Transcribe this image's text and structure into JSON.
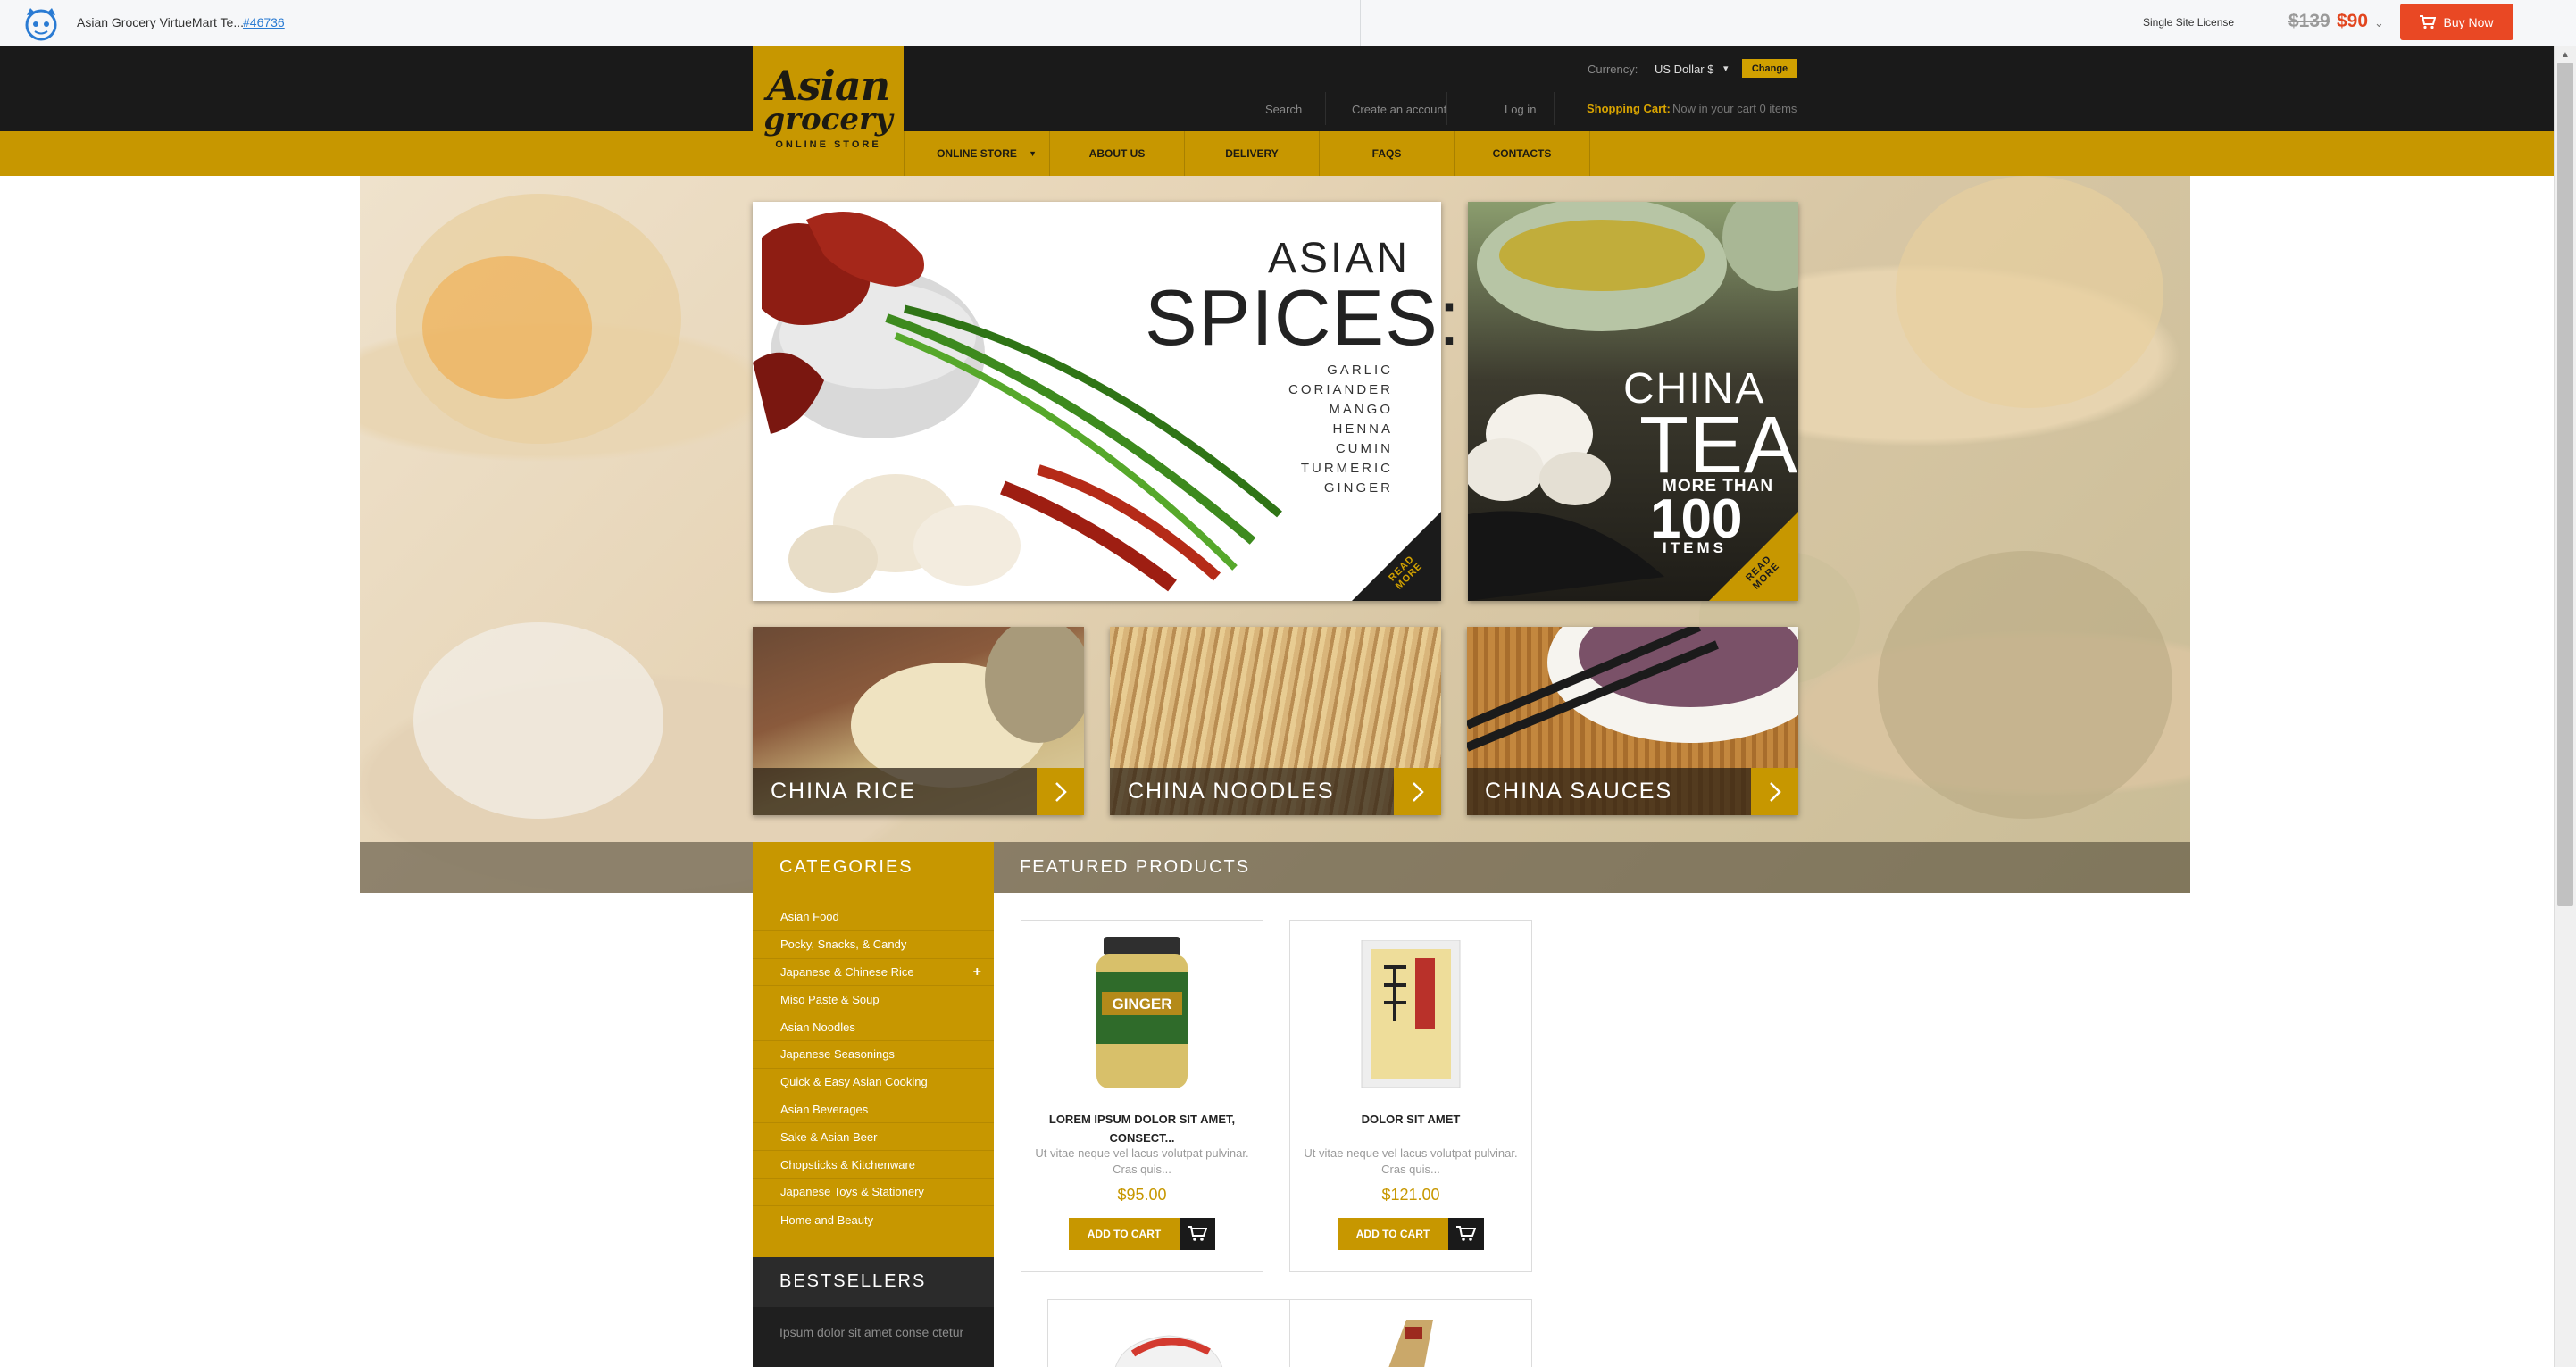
{
  "preview_bar": {
    "title": "Asian Grocery VirtueMart Te...",
    "id_link": "#46736",
    "license": "Single Site License",
    "old_price": "$139",
    "new_price": "$90",
    "buy_label": "Buy Now"
  },
  "logo": {
    "line1": "Asian",
    "line2": "grocery",
    "line3": "ONLINE STORE"
  },
  "currency": {
    "label": "Currency:",
    "value": "US Dollar $",
    "change_label": "Change"
  },
  "header_links": {
    "search": "Search",
    "create_account": "Create an account",
    "login": "Log in"
  },
  "cart": {
    "label": "Shopping Cart:",
    "status": "Now in your cart 0 items"
  },
  "nav": [
    {
      "label": "ONLINE STORE"
    },
    {
      "label": "ABOUT US"
    },
    {
      "label": "DELIVERY"
    },
    {
      "label": "FAQS"
    },
    {
      "label": "CONTACTS"
    }
  ],
  "banners": {
    "spices": {
      "title1": "ASIAN",
      "title2": "SPICES:",
      "list": [
        "GARLIC",
        "CORIANDER",
        "MANGO",
        "HENNA",
        "CUMIN",
        "TURMERIC",
        "GINGER"
      ],
      "read_more": "READ MORE"
    },
    "tea": {
      "title1": "CHINA",
      "title2": "TEA",
      "subtitle": "MORE THAN",
      "number": "100",
      "items": "ITEMS",
      "read_more": "READ MORE"
    },
    "categories": [
      {
        "label": "CHINA RICE"
      },
      {
        "label": "CHINA NOODLES"
      },
      {
        "label": "CHINA SAUCES"
      }
    ]
  },
  "sidebar": {
    "categories_title": "CATEGORIES",
    "categories": [
      "Asian Food",
      "Pocky, Snacks, & Candy",
      "Japanese & Chinese Rice",
      "Miso Paste & Soup",
      "Asian Noodles",
      "Japanese Seasonings",
      "Quick & Easy Asian Cooking",
      "Asian Beverages",
      "Sake & Asian Beer",
      "Chopsticks & Kitchenware",
      "Japanese Toys & Stationery",
      "Home and Beauty"
    ],
    "bestsellers_title": "BESTSELLERS",
    "bestsellers_text": "Ipsum dolor sit amet conse ctetur"
  },
  "featured": {
    "title": "FEATURED PRODUCTS",
    "products": [
      {
        "name": "LOREM IPSUM DOLOR SIT AMET, CONSECT...",
        "desc": "Ut vitae neque vel lacus volutpat pulvinar. Cras quis...",
        "price": "$95.00",
        "add_label": "ADD TO CART",
        "jar_label": "GINGER"
      },
      {
        "name": "DOLOR SIT AMET",
        "desc": "Ut vitae neque vel lacus volutpat pulvinar. Cras quis...",
        "price": "$121.00",
        "add_label": "ADD TO CART"
      }
    ]
  },
  "colors": {
    "gold": "#c79700",
    "dark": "#1a1a1a",
    "buy_red": "#e94824"
  }
}
